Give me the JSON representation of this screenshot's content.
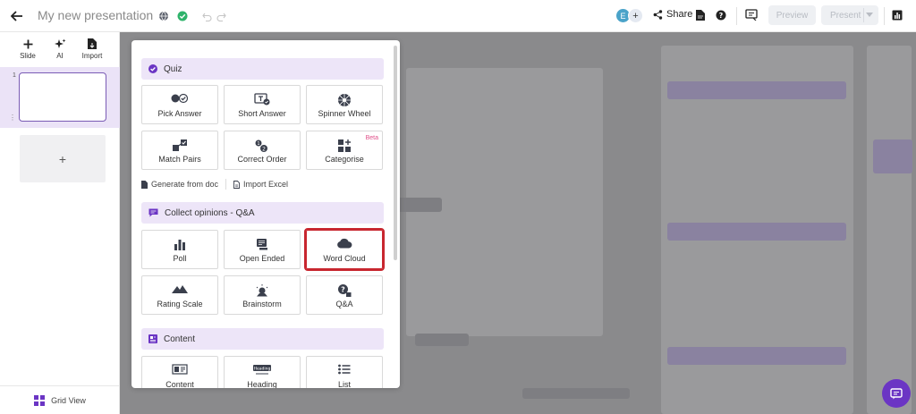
{
  "topbar": {
    "title": "My new presentation",
    "avatar_initial": "E",
    "avatar_add": "+",
    "share_label": "Share",
    "preview_label": "Preview",
    "present_label": "Present"
  },
  "sidebar": {
    "actions": [
      {
        "label": "Slide",
        "icon": "plus-icon"
      },
      {
        "label": "AI",
        "icon": "sparkle-icon"
      },
      {
        "label": "Import",
        "icon": "file-import-icon"
      }
    ],
    "slide_number": "1",
    "add_slide": "+",
    "grid_view_label": "Grid View"
  },
  "panel": {
    "sections": {
      "quiz": {
        "title": "Quiz",
        "icon": "check-circle-icon"
      },
      "opinions": {
        "title": "Collect opinions - Q&A",
        "icon": "chat-icon"
      },
      "content": {
        "title": "Content",
        "icon": "layout-icon"
      }
    },
    "quiz_tiles": [
      {
        "label": "Pick Answer",
        "icon": "pick-answer-icon"
      },
      {
        "label": "Short Answer",
        "icon": "short-answer-icon"
      },
      {
        "label": "Spinner Wheel",
        "icon": "spinner-wheel-icon"
      },
      {
        "label": "Match Pairs",
        "icon": "match-pairs-icon"
      },
      {
        "label": "Correct Order",
        "icon": "correct-order-icon"
      },
      {
        "label": "Categorise",
        "icon": "categorise-icon",
        "badge": "Beta"
      }
    ],
    "links": {
      "generate": "Generate from doc",
      "import_excel": "Import Excel"
    },
    "opinion_tiles": [
      {
        "label": "Poll",
        "icon": "bar-chart-icon"
      },
      {
        "label": "Open Ended",
        "icon": "open-ended-icon"
      },
      {
        "label": "Word Cloud",
        "icon": "cloud-icon"
      },
      {
        "label": "Rating Scale",
        "icon": "mountain-icon"
      },
      {
        "label": "Brainstorm",
        "icon": "lightbulb-icon"
      },
      {
        "label": "Q&A",
        "icon": "qa-icon"
      }
    ],
    "content_tiles": [
      {
        "label": "Content",
        "icon": "content-icon"
      },
      {
        "label": "Heading",
        "icon": "heading-icon",
        "mini": "Heading"
      },
      {
        "label": "List",
        "icon": "list-icon"
      }
    ]
  },
  "colors": {
    "accent": "#6b35c4",
    "section_bg": "#ede5f8",
    "highlight": "#c8262f",
    "beta": "#e0508a"
  }
}
